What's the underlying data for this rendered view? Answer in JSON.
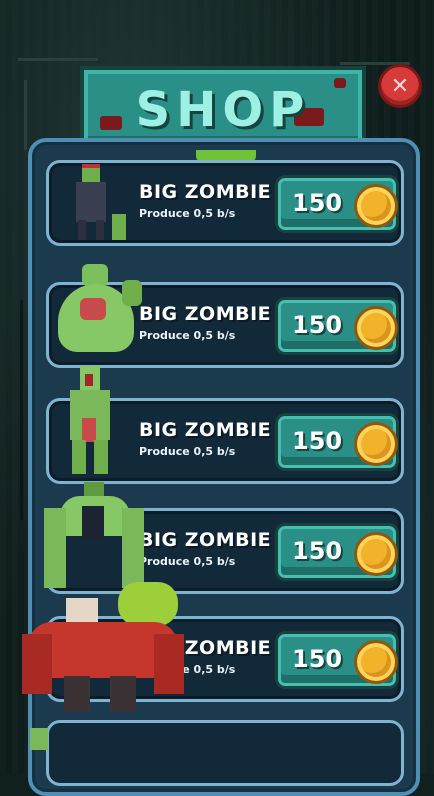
{
  "shop": {
    "title": "SHOP",
    "close_icon": "close-icon",
    "items": [
      {
        "name": "BIG ZOMBIE",
        "desc": "Produce 0,5 b/s",
        "price": "150",
        "currency_icon": "coin-icon"
      },
      {
        "name": "BIG ZOMBIE",
        "desc": "Produce 0,5 b/s",
        "price": "150",
        "currency_icon": "coin-icon"
      },
      {
        "name": "BIG ZOMBIE",
        "desc": "Produce 0,5 b/s",
        "price": "150",
        "currency_icon": "coin-icon"
      },
      {
        "name": "BIG ZOMBIE",
        "desc": "Produce 0,5 b/s",
        "price": "150",
        "currency_icon": "coin-icon"
      },
      {
        "name": "BIG ZOMBIE",
        "desc": "Produce 0,5 b/s",
        "price": "150",
        "currency_icon": "coin-icon"
      }
    ]
  },
  "colors": {
    "sign": "#2a8f86",
    "panel": "#1c3a4d",
    "row_border": "#7fb3cf",
    "coin": "#f2b32b",
    "close": "#d83a3a"
  }
}
